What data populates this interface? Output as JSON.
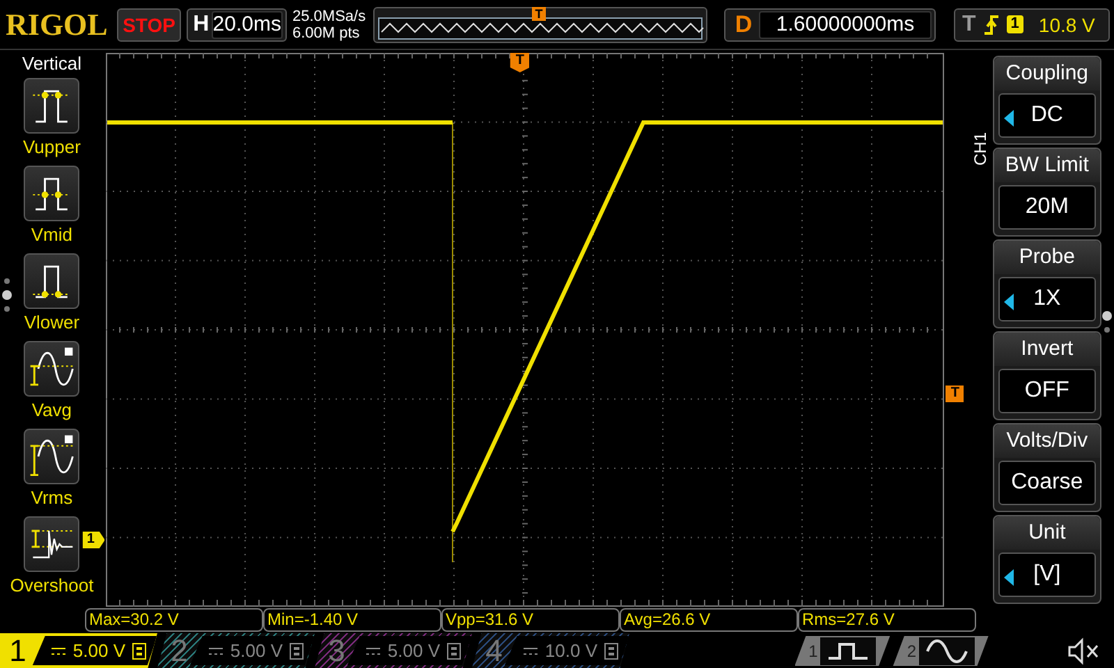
{
  "brand": "RIGOL",
  "run_state": "STOP",
  "horizontal": {
    "label": "H",
    "timebase": "20.0ms"
  },
  "acquisition": {
    "sample_rate": "25.0MSa/s",
    "memory_depth": "6.00M pts"
  },
  "overview": {
    "trigger_marker": "T"
  },
  "delay": {
    "label": "D",
    "value": "1.60000000ms"
  },
  "trigger": {
    "label": "T",
    "source": "1",
    "level": "10.8 V"
  },
  "left_menu": {
    "title": "Vertical",
    "items": [
      {
        "label": "Vupper",
        "kind": "vupper"
      },
      {
        "label": "Vmid",
        "kind": "vmid"
      },
      {
        "label": "Vlower",
        "kind": "vlower"
      },
      {
        "label": "Vavg",
        "kind": "vavg"
      },
      {
        "label": "Vrms",
        "kind": "vrms"
      },
      {
        "label": "Overshoot",
        "kind": "overshoot"
      }
    ]
  },
  "graticule": {
    "trigger_position_marker": "T",
    "trigger_level_marker": "T",
    "channel_marker": "1"
  },
  "right_menu": {
    "channel": "CH1",
    "items": [
      {
        "title": "Coupling",
        "value": "DC",
        "has_options": true
      },
      {
        "title": "BW Limit",
        "value": "20M",
        "has_options": false
      },
      {
        "title": "Probe",
        "value": "1X",
        "has_options": true
      },
      {
        "title": "Invert",
        "value": "OFF",
        "has_options": false
      },
      {
        "title": "Volts/Div",
        "value": "Coarse",
        "has_options": false
      },
      {
        "title": "Unit",
        "value": "[V]",
        "has_options": true
      }
    ]
  },
  "measurements": [
    "Max=30.2 V",
    "Min=-1.40 V",
    "Vpp=31.6 V",
    "Avg=26.6 V",
    "Rms=27.6 V"
  ],
  "channels": [
    {
      "number": "1",
      "scale": "5.00 V",
      "active": true,
      "color": "#f0e000"
    },
    {
      "number": "2",
      "scale": "5.00 V",
      "active": false,
      "color": "#2a7a7a"
    },
    {
      "number": "3",
      "scale": "5.00 V",
      "active": false,
      "color": "#7a2a7a"
    },
    {
      "number": "4",
      "scale": "10.0 V",
      "active": false,
      "color": "#2a4a7a"
    }
  ],
  "generators": [
    {
      "number": "1",
      "kind": "square"
    },
    {
      "number": "2",
      "kind": "sine"
    }
  ]
}
